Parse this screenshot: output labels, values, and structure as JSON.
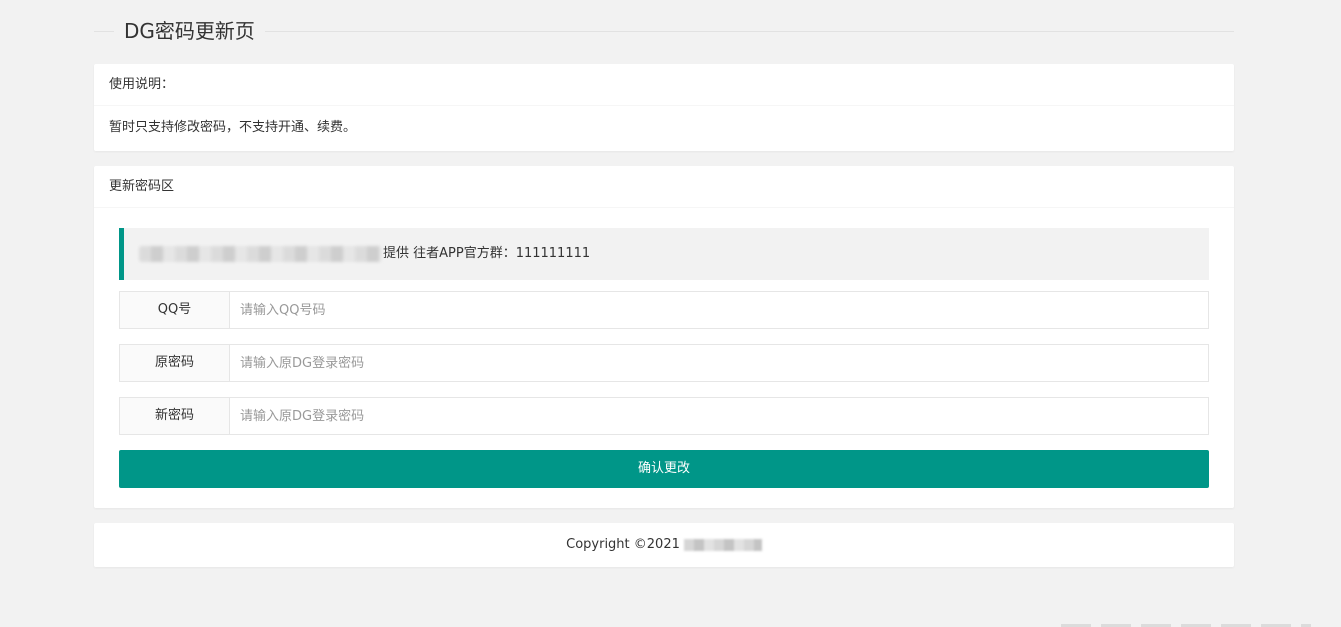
{
  "page": {
    "title": "DG密码更新页"
  },
  "usage": {
    "header": "使用说明：",
    "text": "暂时只支持修改密码，不支持开通、续费。"
  },
  "form": {
    "header": "更新密码区",
    "notice": "提供 往者APP官方群：111111111",
    "fields": [
      {
        "label": "QQ号",
        "placeholder": "请输入QQ号码",
        "value": ""
      },
      {
        "label": "原密码",
        "placeholder": "请输入原DG登录密码",
        "value": ""
      },
      {
        "label": "新密码",
        "placeholder": "请输入原DG登录密码",
        "value": ""
      }
    ],
    "submit_label": "确认更改"
  },
  "footer": {
    "text": "Copyright ©2021"
  },
  "colors": {
    "accent": "#009688",
    "background": "#f2f2f2"
  }
}
